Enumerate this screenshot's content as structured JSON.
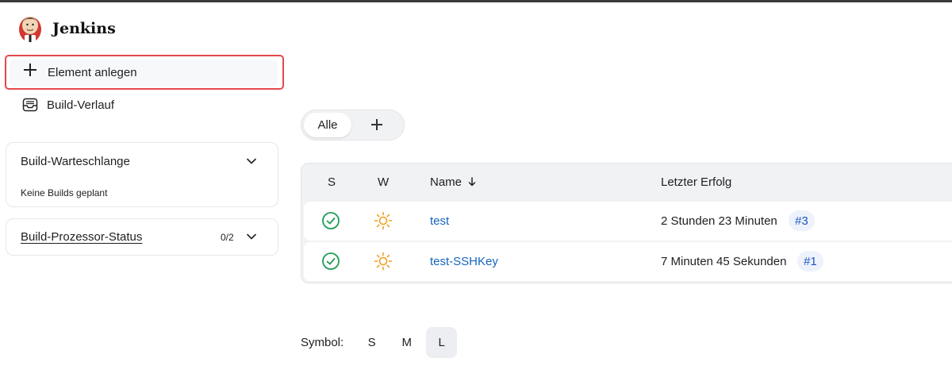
{
  "header": {
    "brand": "Jenkins",
    "logo_icon": "jenkins-butler-icon"
  },
  "sidebar": {
    "tasks": [
      {
        "label": "Element anlegen",
        "icon": "plus-icon",
        "highlighted": true
      },
      {
        "label": "Build-Verlauf",
        "icon": "inbox-history-icon"
      }
    ],
    "build_queue": {
      "title": "Build-Warteschlange",
      "body": "Keine Builds geplant",
      "icon": "chevron-down-icon"
    },
    "executors": {
      "title": "Build-Prozessor-Status",
      "count": "0/2",
      "icon": "chevron-down-icon"
    }
  },
  "tabs": {
    "all_label": "Alle",
    "add_icon": "plus-icon"
  },
  "table": {
    "headers": {
      "status": "S",
      "weather": "W",
      "name": "Name",
      "name_sort_icon": "arrow-down-icon",
      "last_success": "Letzter Erfolg"
    },
    "rows": [
      {
        "status_icon": "success-check-icon",
        "weather_icon": "sunny-icon",
        "name": "test",
        "last_success": "2 Stunden 23 Minuten",
        "build": "#3"
      },
      {
        "status_icon": "success-check-icon",
        "weather_icon": "sunny-icon",
        "name": "test-SSHKey",
        "last_success": "7 Minuten 45 Sekunden",
        "build": "#1"
      }
    ]
  },
  "icon_size": {
    "label": "Symbol:",
    "options": [
      "S",
      "M",
      "L"
    ],
    "selected": "L"
  },
  "colors": {
    "highlight_border": "#e5484d",
    "link": "#1565c0",
    "success": "#1f9d55",
    "sunny": "#f0a020"
  }
}
